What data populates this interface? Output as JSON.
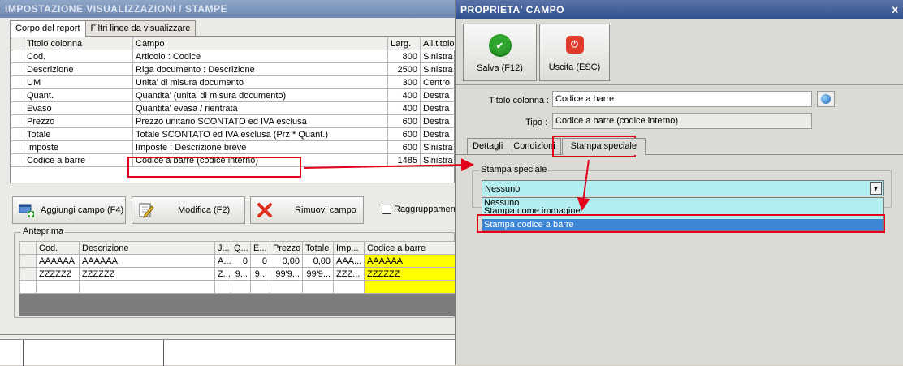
{
  "main_window": {
    "title": "IMPOSTAZIONE VISUALIZZAZIONI / STAMPE",
    "tabs": [
      {
        "label": "Corpo del report"
      },
      {
        "label": "Filtri linee da visualizzare"
      }
    ],
    "columns": [
      "Titolo colonna",
      "Campo",
      "Larg.",
      "All.titolo"
    ],
    "rows": [
      {
        "titolo": "Cod.",
        "campo": "Articolo : Codice",
        "larg": "800",
        "all": "Sinistra"
      },
      {
        "titolo": "Descrizione",
        "campo": "Riga documento : Descrizione",
        "larg": "2500",
        "all": "Sinistra"
      },
      {
        "titolo": "UM",
        "campo": "Unita' di misura documento",
        "larg": "300",
        "all": "Centro"
      },
      {
        "titolo": "Quant.",
        "campo": "Quantita' (unita' di misura documento)",
        "larg": "400",
        "all": "Destra"
      },
      {
        "titolo": "Evaso",
        "campo": "Quantita' evasa / rientrata",
        "larg": "400",
        "all": "Destra"
      },
      {
        "titolo": "Prezzo",
        "campo": "Prezzo unitario SCONTATO ed IVA esclusa",
        "larg": "600",
        "all": "Destra"
      },
      {
        "titolo": "Totale",
        "campo": "Totale SCONTATO ed IVA esclusa (Prz * Quant.)",
        "larg": "600",
        "all": "Destra"
      },
      {
        "titolo": "Imposte",
        "campo": "Imposte : Descrizione breve",
        "larg": "600",
        "all": "Sinistra"
      },
      {
        "titolo": "Codice a barre",
        "campo": "Codice a barre (codice interno)",
        "larg": "1485",
        "all": "Sinistra"
      }
    ],
    "buttons": {
      "add": "Aggiungi campo (F4)",
      "edit": "Modifica (F2)",
      "remove": "Rimuovi campo"
    },
    "group_checkbox": "Raggruppamen",
    "preview": {
      "label": "Anteprima",
      "columns": [
        "Cod.",
        "Descrizione",
        "J...",
        "Q...",
        "E...",
        "Prezzo",
        "Totale",
        "Imp...",
        "Codice a barre"
      ],
      "rows": [
        [
          "AAAAAA",
          "AAAAAA",
          "A...",
          "0",
          "0",
          "0,00",
          "0,00",
          "AAA...",
          "AAAAAA"
        ],
        [
          "ZZZZZZ",
          "ZZZZZZ",
          "Z...",
          "9...",
          "9...",
          "99'9...",
          "99'9...",
          "ZZZ...",
          "ZZZZZZ"
        ]
      ]
    }
  },
  "prop_window": {
    "title": "PROPRIETA' CAMPO",
    "close": "x",
    "save_label": "Salva (F12)",
    "exit_label": "Uscita (ESC)",
    "titolo_label": "Titolo colonna :",
    "titolo_value": "Codice a barre",
    "tipo_label": "Tipo :",
    "tipo_value": "Codice a barre (codice interno)",
    "tabs": [
      {
        "label": "Dettagli"
      },
      {
        "label": "Condizioni"
      },
      {
        "label": "Stampa speciale"
      }
    ],
    "group_label": "Stampa speciale",
    "select_value": "Nessuno",
    "options": [
      "Nessuno",
      "Stampa come immagine",
      "Stampa codice a barre"
    ]
  },
  "colors": {
    "highlight": "#e3001b",
    "select_bg": "#b3eef0",
    "option_selected": "#3d86d6",
    "barcode_col": "#ffff00"
  }
}
